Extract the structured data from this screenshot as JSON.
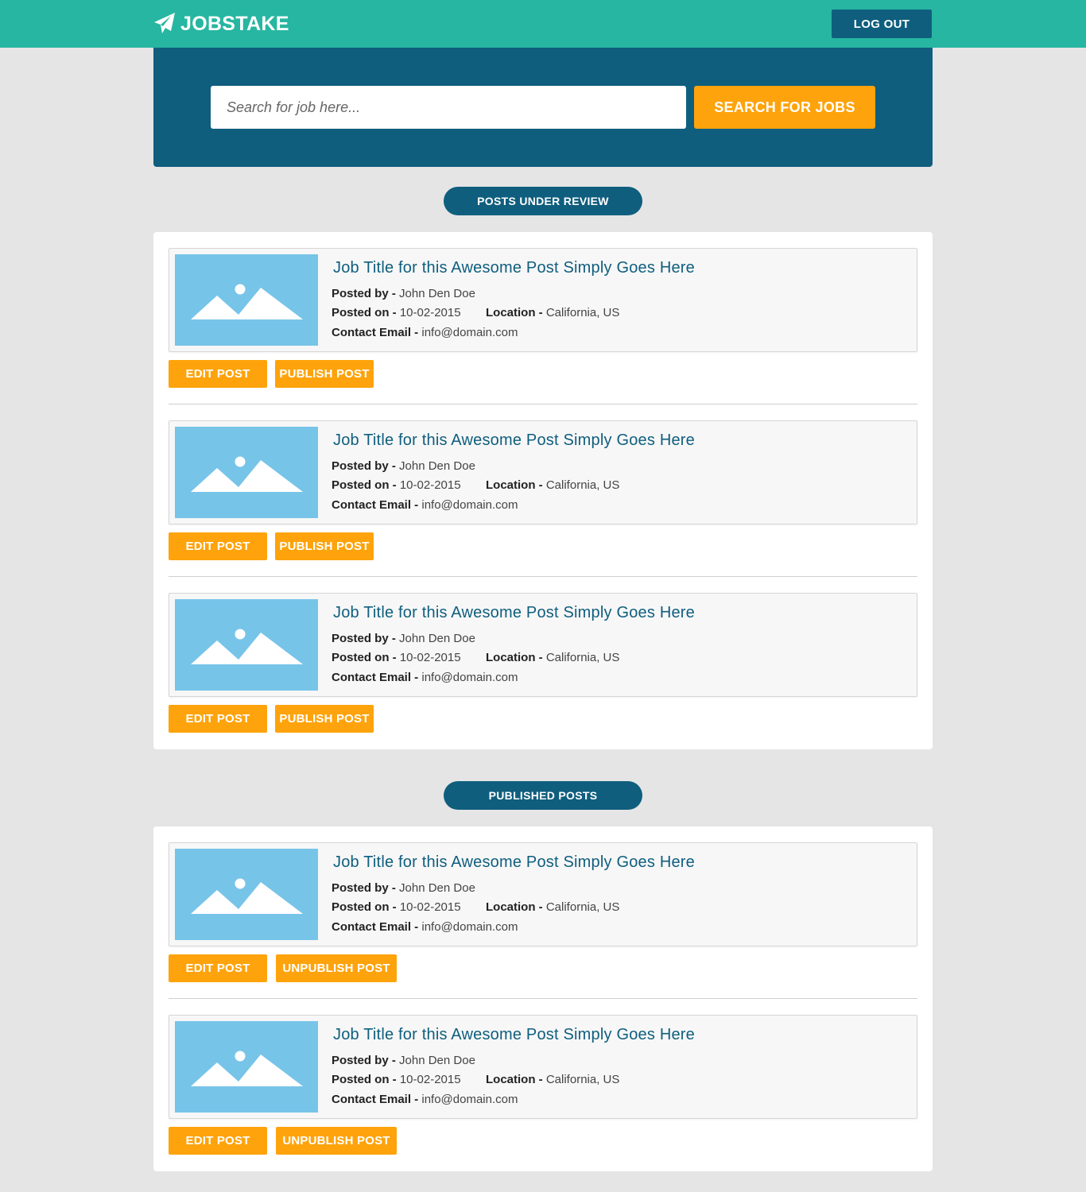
{
  "header": {
    "brand": "JOBSTAKE",
    "logout_label": "LOG OUT"
  },
  "search": {
    "placeholder": "Search for job here...",
    "button_label": "SEARCH FOR JOBS"
  },
  "sections": {
    "review": {
      "label": "POSTS UNDER REVIEW",
      "posts": [
        {
          "title": "Job Title for this Awesome Post Simply Goes Here",
          "posted_by_label": "Posted by -",
          "posted_by": "John Den Doe",
          "posted_on_label": "Posted on -",
          "posted_on": "10-02-2015",
          "location_label": "Location -",
          "location": "California, US",
          "email_label": "Contact Email -",
          "email": "info@domain.com",
          "edit_label": "EDIT POST",
          "action_label": "PUBLISH POST"
        },
        {
          "title": "Job Title for this Awesome Post Simply Goes Here",
          "posted_by_label": "Posted by -",
          "posted_by": "John Den Doe",
          "posted_on_label": "Posted on -",
          "posted_on": "10-02-2015",
          "location_label": "Location -",
          "location": "California, US",
          "email_label": "Contact Email -",
          "email": "info@domain.com",
          "edit_label": "EDIT POST",
          "action_label": "PUBLISH POST"
        },
        {
          "title": "Job Title for this Awesome Post Simply Goes Here",
          "posted_by_label": "Posted by -",
          "posted_by": "John Den Doe",
          "posted_on_label": "Posted on -",
          "posted_on": "10-02-2015",
          "location_label": "Location -",
          "location": "California, US",
          "email_label": "Contact Email -",
          "email": "info@domain.com",
          "edit_label": "EDIT POST",
          "action_label": "PUBLISH POST"
        }
      ]
    },
    "published": {
      "label": "PUBLISHED POSTS",
      "posts": [
        {
          "title": "Job Title for this Awesome Post Simply Goes Here",
          "posted_by_label": "Posted by -",
          "posted_by": "John Den Doe",
          "posted_on_label": "Posted on -",
          "posted_on": "10-02-2015",
          "location_label": "Location -",
          "location": "California, US",
          "email_label": "Contact Email -",
          "email": "info@domain.com",
          "edit_label": "EDIT POST",
          "action_label": "UNPUBLISH POST"
        },
        {
          "title": "Job Title for this Awesome Post Simply Goes Here",
          "posted_by_label": "Posted by -",
          "posted_by": "John Den Doe",
          "posted_on_label": "Posted on -",
          "posted_on": "10-02-2015",
          "location_label": "Location -",
          "location": "California, US",
          "email_label": "Contact Email -",
          "email": "info@domain.com",
          "edit_label": "EDIT POST",
          "action_label": "UNPUBLISH POST"
        }
      ]
    }
  },
  "icons": {
    "logo": "paper-plane-icon",
    "thumbnail": "image-placeholder-icon"
  },
  "colors": {
    "topbar": "#27b6a1",
    "primary": "#0f5e7e",
    "accent": "#fea30b",
    "thumbnail": "#77c4e9"
  }
}
